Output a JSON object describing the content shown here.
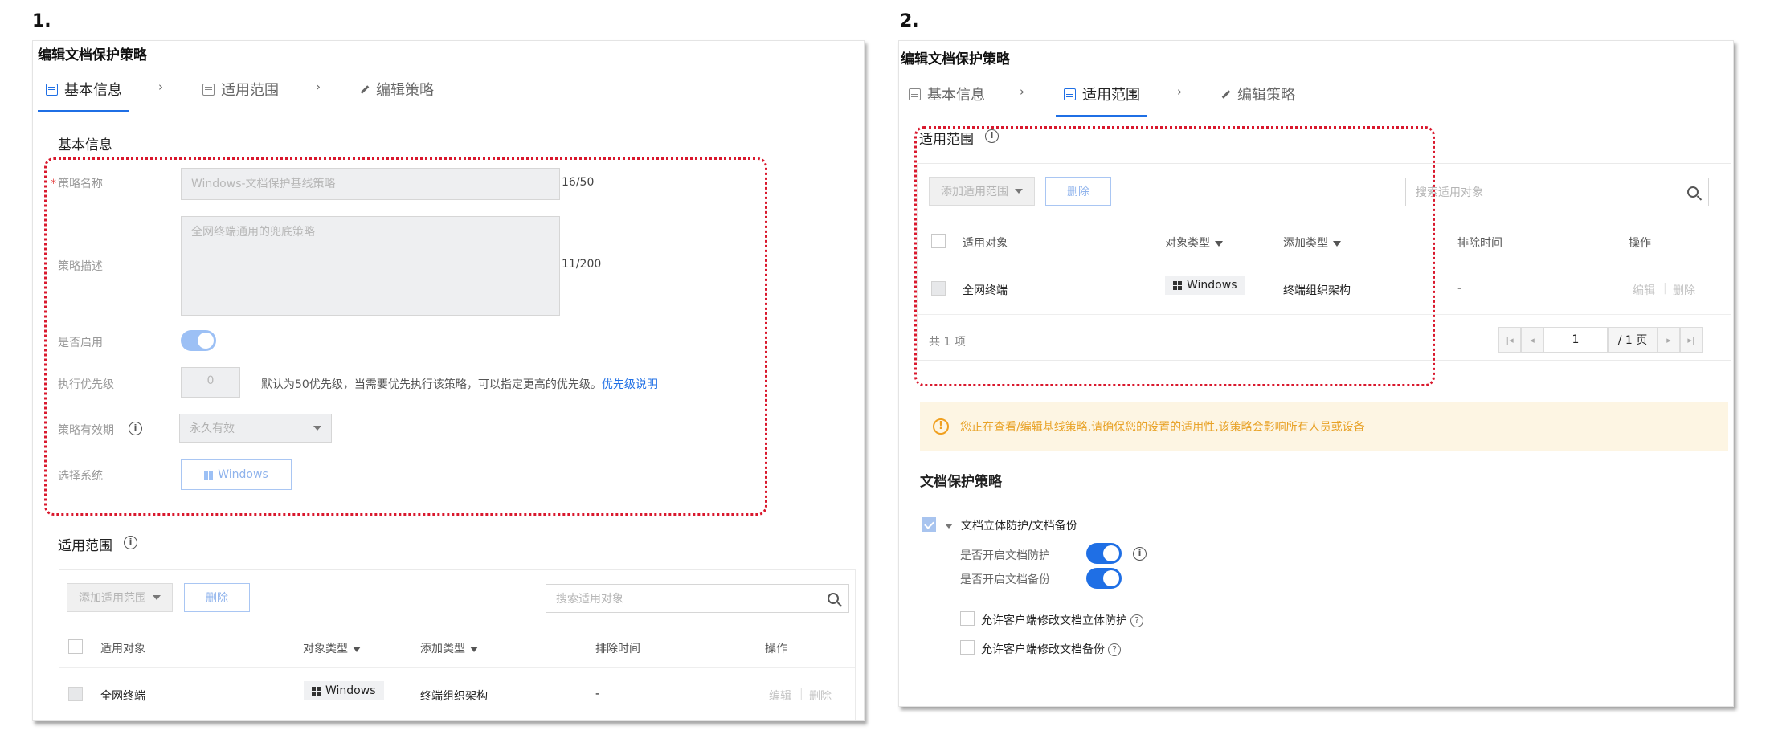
{
  "steps": {
    "s1": "1.",
    "s2": "2."
  },
  "panel1": {
    "title": "编辑文档保护策略",
    "tabs": [
      "基本信息",
      "适用范围",
      "编辑策略"
    ],
    "active_tab": 0,
    "basic_section_title": "基本信息",
    "fields": {
      "name_label": "策略名称",
      "name_value": "Windows-文档保护基线策略",
      "name_count": "16/50",
      "desc_label": "策略描述",
      "desc_value": "全网终端通用的兜底策略",
      "desc_count": "11/200",
      "enable_label": "是否启用",
      "enable_on": true,
      "priority_label": "执行优先级",
      "priority_value": "0",
      "priority_hint": "默认为50优先级，当需要优先执行该策略，可以指定更高的优先级。",
      "priority_link": "优先级说明",
      "validity_label": "策略有效期",
      "validity_value": "永久有效",
      "system_label": "选择系统",
      "system_value": "Windows"
    },
    "scope_section_title": "适用范围",
    "scope": {
      "add_button": "添加适用范围",
      "delete_button": "删除",
      "search_placeholder": "搜索适用对象",
      "columns": [
        "适用对象",
        "对象类型",
        "添加类型",
        "排除时间",
        "操作"
      ],
      "rows": [
        {
          "target": "全网终端",
          "type": "Windows",
          "add_type": "终端组织架构",
          "exclude_time": "-",
          "edit": "编辑",
          "delete": "删除"
        }
      ]
    }
  },
  "panel2": {
    "title": "编辑文档保护策略",
    "tabs": [
      "基本信息",
      "适用范围",
      "编辑策略"
    ],
    "active_tab": 1,
    "scope_section_title": "适用范围",
    "scope": {
      "add_button": "添加适用范围",
      "delete_button": "删除",
      "search_placeholder": "搜索适用对象",
      "columns": [
        "适用对象",
        "对象类型",
        "添加类型",
        "排除时间",
        "操作"
      ],
      "rows": [
        {
          "target": "全网终端",
          "type": "Windows",
          "add_type": "终端组织架构",
          "exclude_time": "-",
          "edit": "编辑",
          "delete": "删除"
        }
      ],
      "total": "共 1 项",
      "page_value": "1",
      "page_total": "/ 1 页"
    },
    "warning": "您正在查看/编辑基线策略,请确保您的设置的适用性,该策略会影响所有人员或设备",
    "policy_section_title": "文档保护策略",
    "policy": {
      "group_label": "文档立体防护/文档备份",
      "protect_label": "是否开启文档防护",
      "backup_label": "是否开启文档备份",
      "allow_protect_label": "允许客户端修改文档立体防护",
      "allow_backup_label": "允许客户端修改文档备份"
    }
  }
}
